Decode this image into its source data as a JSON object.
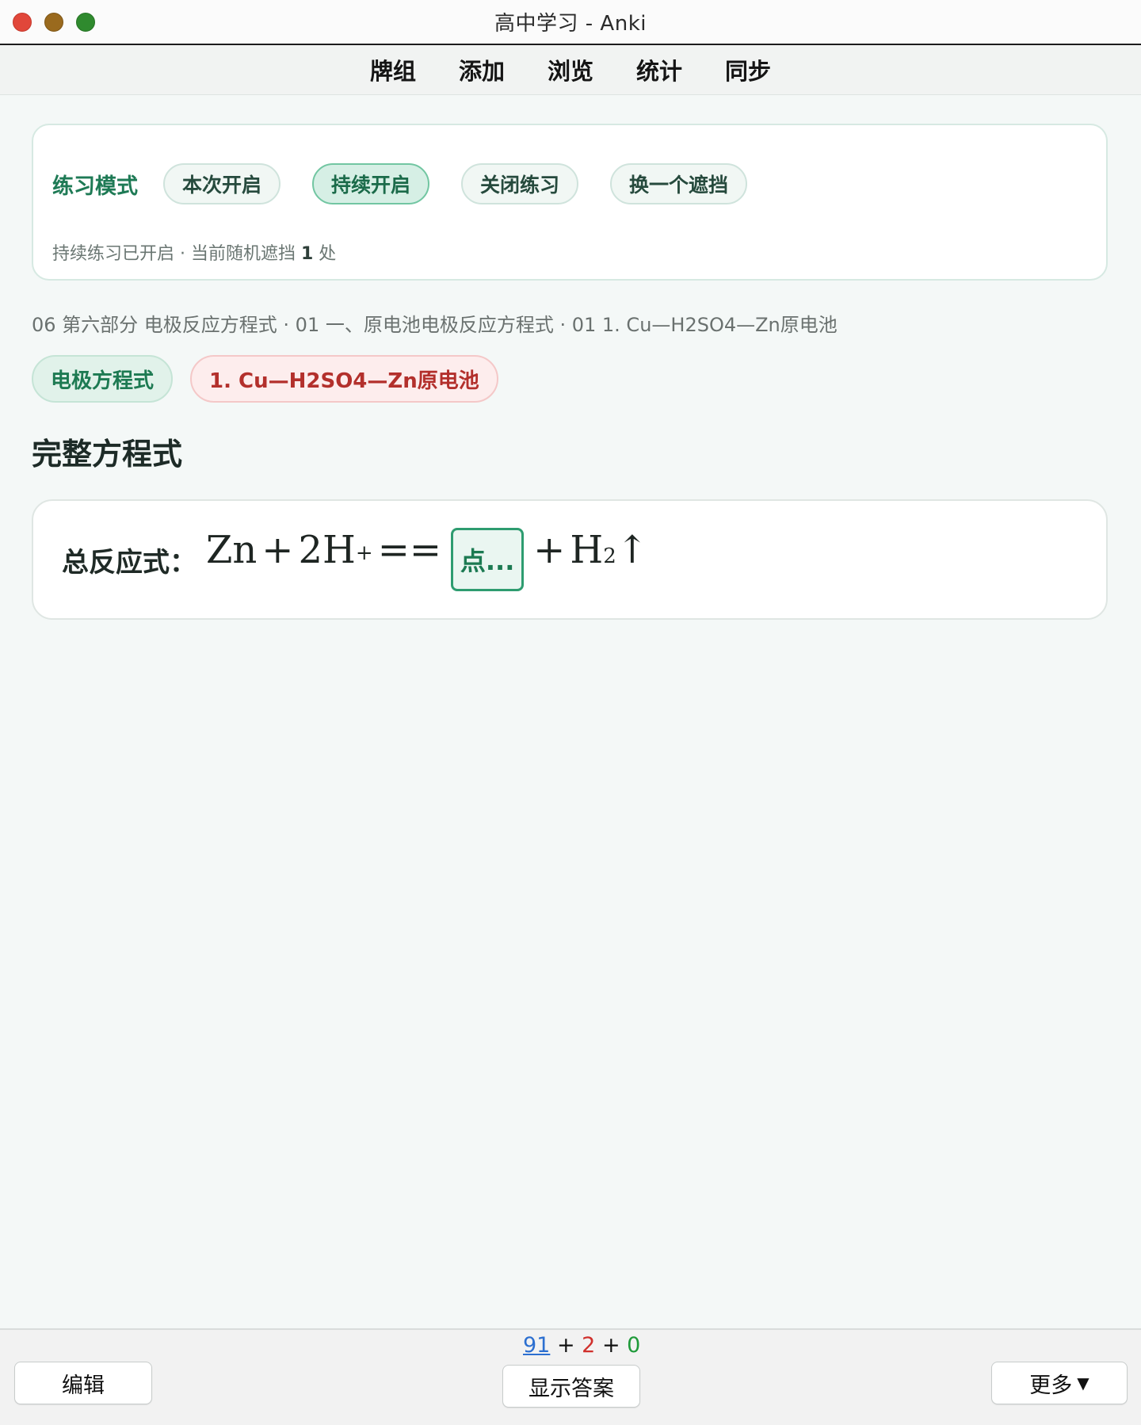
{
  "window": {
    "title": "高中学习 - Anki"
  },
  "toolbar": {
    "tabs": [
      "牌组",
      "添加",
      "浏览",
      "统计",
      "同步"
    ]
  },
  "practice": {
    "label": "练习模式",
    "buttons": [
      "本次开启",
      "持续开启",
      "关闭练习",
      "换一个遮挡"
    ],
    "active": "持续开启",
    "status_prefix": "持续练习已开启 · 当前随机遮挡",
    "status_count": "1",
    "status_suffix": "处"
  },
  "breadcrumb": "06 第六部分 电极反应方程式 · 01 一、原电池电极反应方程式 · 01 1.  Cu—H2SO4—Zn原电池",
  "tags": [
    "电极方程式",
    "1.  Cu—H2SO4—Zn原电池"
  ],
  "section_title": "完整方程式",
  "equation": {
    "label": "总反应式：",
    "zn": "Zn",
    "plus": "+",
    "coef_h": "2H",
    "sup_plus": "+",
    "equals": "==",
    "cloze": "点...",
    "h": "H",
    "sub_2": "2",
    "arrow": "↑"
  },
  "bottom": {
    "edit": "编辑",
    "show_answer": "显示答案",
    "more": "更多",
    "counts": {
      "new": "91",
      "learn": "2",
      "review": "0",
      "sep": "+"
    }
  },
  "colors": {
    "accent": "#1e7a55",
    "learn": "#d0302c",
    "new": "#2c6fd0",
    "review": "#1f9a3a"
  }
}
